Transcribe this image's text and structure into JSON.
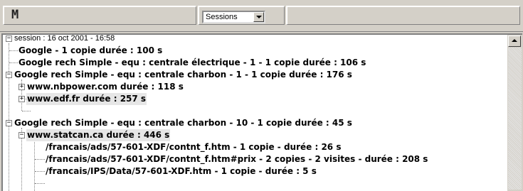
{
  "toolbar": {
    "logo": "M",
    "view_select": "Sessions"
  },
  "tree": [
    {
      "label": "session : 16 oct 2001 - 16:58",
      "expander": "−",
      "bold": false,
      "highlight": false
    },
    {
      "label": "Google - 1 copie durée : 100 s",
      "expander": "",
      "bold": true,
      "highlight": false
    },
    {
      "label": "Google rech Simple - equ : centrale électrique - 1 - 1 copie durée : 106 s",
      "expander": "",
      "bold": true,
      "highlight": false
    },
    {
      "label": "Google rech Simple - equ : centrale charbon - 1 - 1 copie durée : 176 s",
      "expander": "−",
      "bold": true,
      "highlight": false
    },
    {
      "label": "www.nbpower.com durée : 118 s",
      "expander": "+",
      "bold": true,
      "highlight": false
    },
    {
      "label": "www.edf.fr durée : 257 s",
      "expander": "+",
      "bold": true,
      "highlight": true
    },
    {
      "label": "Google rech Simple - equ : centrale charbon - 10 - 1 copie durée : 45 s",
      "expander": "−",
      "bold": true,
      "highlight": false
    },
    {
      "label": "www.statcan.ca durée : 446 s",
      "expander": "−",
      "bold": true,
      "highlight": true
    },
    {
      "label": "/francais/ads/57-601-XDF/contnt_f.htm - 1 copie - durée : 26 s",
      "expander": "",
      "bold": true,
      "highlight": false
    },
    {
      "label": "/francais/ads/57-601-XDF/contnt_f.htm#prix - 2 copies - 2 visites - durée : 208 s",
      "expander": "",
      "bold": true,
      "highlight": false
    },
    {
      "label": "/francais/IPS/Data/57-601-XDF.htm - 1 copie - durée : 5 s",
      "expander": "",
      "bold": true,
      "highlight": false
    }
  ]
}
